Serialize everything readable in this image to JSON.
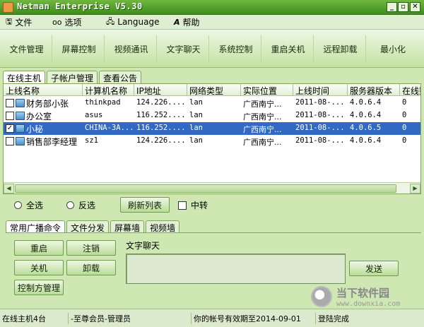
{
  "window": {
    "title": "Netman Enterprise V5.30",
    "min": "_",
    "restore": "▫",
    "close": "✕"
  },
  "menu": [
    {
      "label": "文件",
      "icon": "🖫"
    },
    {
      "label": "选项",
      "icon": "oo"
    },
    {
      "label": "Language",
      "icon": "🖧"
    },
    {
      "label": "帮助",
      "icon": "A"
    }
  ],
  "toolbar": [
    "文件管理",
    "屏幕控制",
    "视频通讯",
    "文字聊天",
    "系统控制",
    "重启关机",
    "远程卸载",
    "最小化"
  ],
  "main_tabs": [
    "在线主机",
    "子帐户管理",
    "查看公告"
  ],
  "grid": {
    "columns": [
      "上线名称",
      "计算机名称",
      "IP地址",
      "网络类型",
      "实际位置",
      "上线时间",
      "服务器版本",
      "在线数"
    ],
    "rows": [
      {
        "checked": false,
        "name": "财务部小张",
        "computer": "thinkpad",
        "ip": "124.226....",
        "net": "lan",
        "loc": "广西南宁...",
        "time": "2011-08-...",
        "ver": "4.0.6.4",
        "online": "0"
      },
      {
        "checked": false,
        "name": "办公室",
        "computer": "asus",
        "ip": "116.252....",
        "net": "lan",
        "loc": "广西南宁...",
        "time": "2011-08-...",
        "ver": "4.0.6.4",
        "online": "0"
      },
      {
        "checked": true,
        "name": "小秘",
        "computer": "CHINA-3A...",
        "ip": "116.252....",
        "net": "lan",
        "loc": "广西南宁...",
        "time": "2011-08-...",
        "ver": "4.0.6.5",
        "online": "0"
      },
      {
        "checked": false,
        "name": "销售部李经理",
        "computer": "sz1",
        "ip": "124.226....",
        "net": "lan",
        "loc": "广西南宁...",
        "time": "2011-08-...",
        "ver": "4.0.6.4",
        "online": "0"
      }
    ],
    "selected_index": 2
  },
  "select_row": {
    "all": "全选",
    "invert": "反选",
    "refresh": "刷新列表",
    "relay": "中转"
  },
  "cmd_tabs": [
    "常用广播命令",
    "文件分发",
    "屏幕墙",
    "视频墙"
  ],
  "cmd_buttons": {
    "restart": "重启",
    "logout": "注销",
    "shutdown": "关机",
    "uninstall": "卸载",
    "controller": "控制方管理"
  },
  "chat": {
    "label": "文字聊天",
    "send": "发送"
  },
  "status": {
    "online": "在线主机4台",
    "member": "-至尊会员-管理员",
    "expire": "你的帐号有效期至2014-09-01",
    "login": "登陆完成"
  },
  "watermark": {
    "name": "当下软件园",
    "url": "www.downxia.com"
  }
}
